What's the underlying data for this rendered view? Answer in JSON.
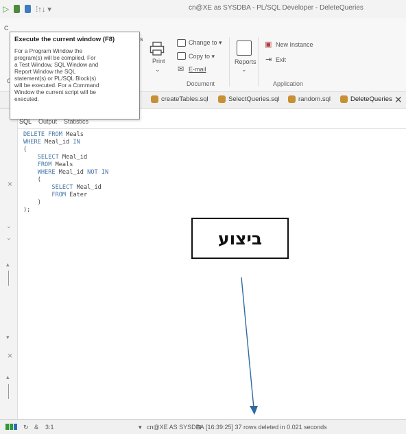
{
  "window": {
    "title": "cn@XE as SYSDBA - PL/SQL Developer - DeleteQueries"
  },
  "quick_access": {
    "more_label": "⁞↑↓ ▾"
  },
  "ribbon": {
    "groups": {
      "document_label": "Document",
      "application_label": "Application"
    },
    "buttons": {
      "print": "Print",
      "change_to": "Change to ▾",
      "copy_to": "Copy to ▾",
      "email": "E-mail",
      "reports": "Reports",
      "new_instance": "New Instance",
      "exit": "Exit"
    },
    "left_fragments": {
      "f1": "C",
      "f2": "C",
      "f3": "s"
    }
  },
  "tooltip": {
    "title": "Execute the current window (F8)",
    "lines": [
      "For a Program Window the",
      "program(s) will be compiled. For",
      "a Test Window, SQL Window and",
      "Report Window the SQL",
      "statement(s) or PL/SQL Block(s)",
      "will be executed. For a Command",
      "Window the current script will be",
      "executed."
    ]
  },
  "tabs": [
    {
      "label": "createTables.sql"
    },
    {
      "label": "SelectQueries.sql"
    },
    {
      "label": "random.sql"
    },
    {
      "label": "DeleteQueries"
    }
  ],
  "editor": {
    "subtabs": [
      "SQL",
      "Output",
      "Statistics"
    ],
    "code": [
      [
        {
          "k": true,
          "t": "DELETE FROM "
        },
        {
          "k": false,
          "t": "Meals"
        }
      ],
      [
        {
          "k": true,
          "t": "WHERE "
        },
        {
          "k": false,
          "t": "Meal_id "
        },
        {
          "k": true,
          "t": "IN"
        }
      ],
      [
        {
          "k": false,
          "t": "("
        }
      ],
      [
        {
          "k": true,
          "t": "    SELECT "
        },
        {
          "k": false,
          "t": "Meal_id"
        }
      ],
      [
        {
          "k": true,
          "t": "    FROM "
        },
        {
          "k": false,
          "t": "Meals"
        }
      ],
      [
        {
          "k": true,
          "t": "    WHERE "
        },
        {
          "k": false,
          "t": "Meal_id "
        },
        {
          "k": true,
          "t": "NOT IN"
        }
      ],
      [
        {
          "k": false,
          "t": "    ("
        }
      ],
      [
        {
          "k": true,
          "t": "        SELECT "
        },
        {
          "k": false,
          "t": "Meal_id"
        }
      ],
      [
        {
          "k": true,
          "t": "        FROM "
        },
        {
          "k": false,
          "t": "Eater"
        }
      ],
      [
        {
          "k": false,
          "t": "    )"
        }
      ],
      [
        {
          "k": false,
          "t": ");"
        }
      ]
    ]
  },
  "annotation": {
    "label": "ביצוע"
  },
  "statusbar": {
    "position": "3:1",
    "connection": "cn@XE AS SYSDBA",
    "message": "[16:39:25]  37 rows deleted in 0.021 seconds"
  },
  "colors": {
    "keyword": "#4878a8",
    "file_icon": "#c79034",
    "arrow": "#2f6aa0"
  }
}
